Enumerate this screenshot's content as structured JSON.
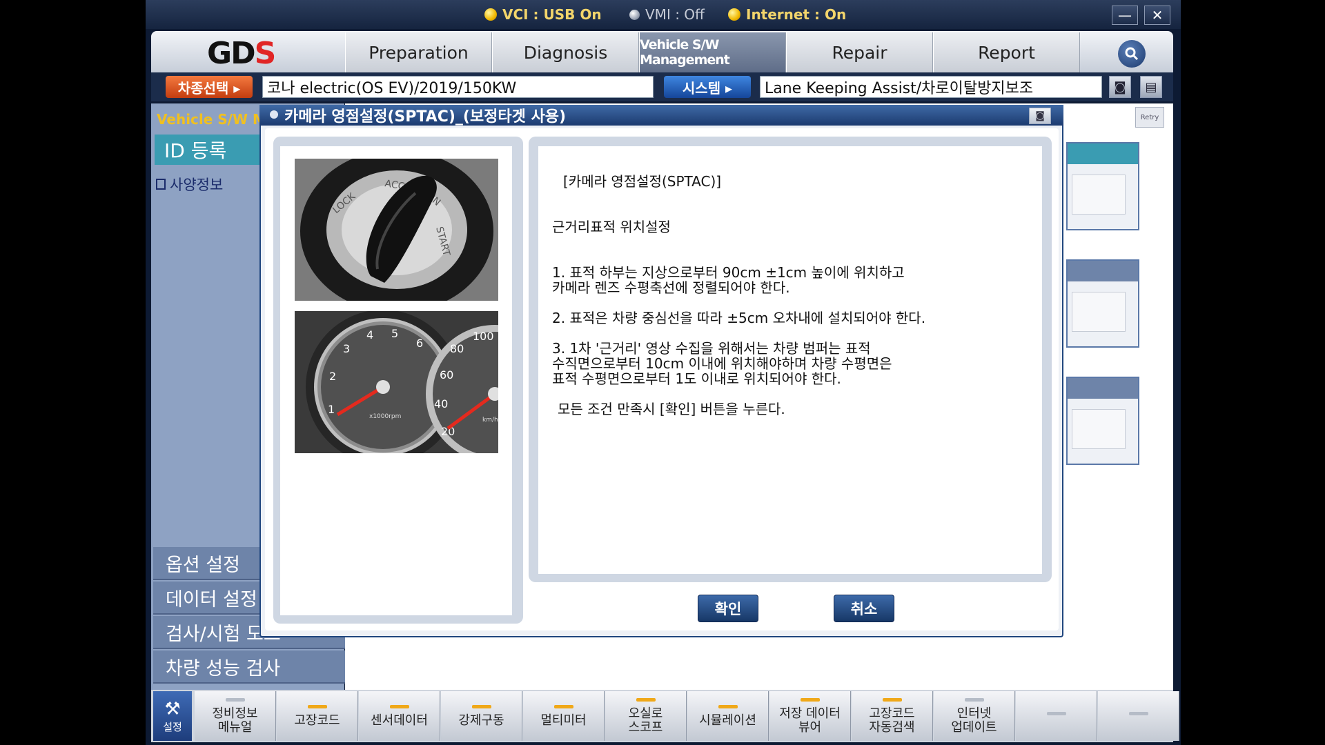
{
  "status": {
    "vci": "VCI : USB On",
    "vmi": "VMI : Off",
    "internet": "Internet : On"
  },
  "window": {
    "minimize": "—",
    "close": "✕"
  },
  "nav": {
    "logo_main": "GD",
    "logo_accent": "S",
    "tabs": [
      "Preparation",
      "Diagnosis",
      "Vehicle S/W Management",
      "Repair",
      "Report"
    ],
    "active_tab": "Vehicle S/W Management"
  },
  "vehicle_bar": {
    "car_select_label": "차종선택 ▸",
    "car_model": "코나 electric(OS EV)/2019/150KW",
    "system_label": "시스템 ▸",
    "system_value": "Lane Keeping Assist/차로이탈방지보조"
  },
  "sidebar": {
    "title": "Vehicle S/W Management",
    "id_register": "ID 등록",
    "spec_info": "사양정보",
    "menus": [
      "옵션 설정",
      "데이터 설정",
      "검사/시험 모드",
      "차량 성능 검사"
    ]
  },
  "retry_label": "Retry",
  "dialog": {
    "title": "카메라 영점설정(SPTAC)_(보정타겟 사용)",
    "lines": [
      "[카메라 영점설정(SPTAC)]",
      "근거리표적 위치설정",
      "1. 표적 하부는 지상으로부터 90cm ±1cm 높이에 위치하고",
      " 카메라 렌즈 수평축선에 정렬되어야 한다.",
      "2. 표적은 차량 중심선을 따라 ±5cm 오차내에 설치되어야 한다.",
      "3. 1차 '근거리' 영상 수집을 위해서는 차량 범퍼는 표적",
      " 수직면으로부터 10cm 이내에 위치해야하며 차량 수평면은",
      " 표적 수평면으로부터 1도 이내로 위치되어야 한다.",
      "모든 조건 만족시 [확인] 버튼을 누른다."
    ],
    "confirm": "확인",
    "cancel": "취소",
    "gauge_left_ticks": [
      "1",
      "2",
      "3",
      "4",
      "5",
      "6"
    ],
    "gauge_left_unit": "x1000rpm",
    "gauge_right_ticks": [
      "20",
      "40",
      "60",
      "80",
      "100"
    ],
    "gauge_right_unit": "km/h",
    "key_ring_text": [
      "LOCK",
      "ACC",
      "ON",
      "START"
    ]
  },
  "toolbar": {
    "settings": "설정",
    "items": [
      [
        "정비정보",
        "메뉴얼"
      ],
      [
        "고장코드"
      ],
      [
        "센서데이터"
      ],
      [
        "강제구동"
      ],
      [
        "멀티미터"
      ],
      [
        "오실로",
        "스코프"
      ],
      [
        "시뮬레이션"
      ],
      [
        "저장 데이터",
        "뷰어"
      ],
      [
        "고장코드",
        "자동검색"
      ],
      [
        "인터넷",
        "업데이트"
      ],
      [],
      []
    ]
  },
  "colors": {
    "accent_orange": "#f0a818",
    "title_blue": "#1c3b70",
    "sidebar_teal": "#3a9cb2"
  }
}
